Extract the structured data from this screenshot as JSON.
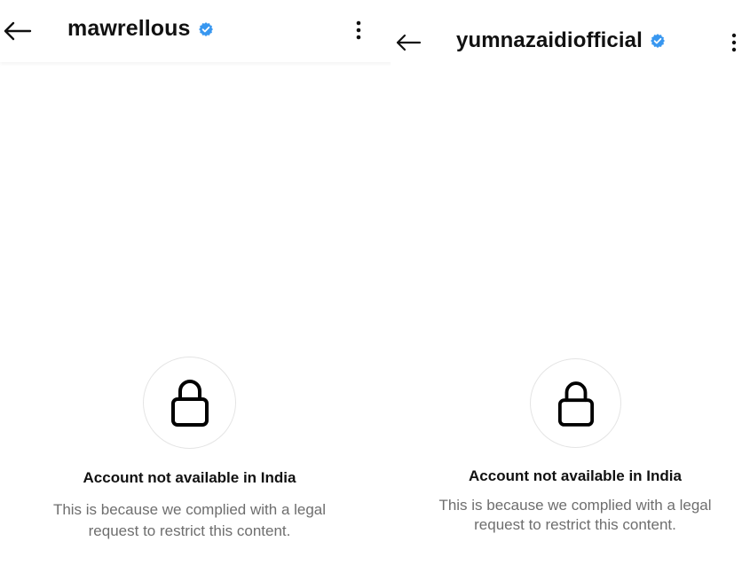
{
  "screens": [
    {
      "username": "mawrellous",
      "verified": true,
      "icons": {
        "back": "back-arrow-icon",
        "verified": "verified-badge-icon",
        "more": "more-options-icon",
        "lock": "lock-icon"
      },
      "message": {
        "heading": "Account not available in India",
        "line1": "This is because we complied with a legal",
        "line2": "request to restrict this content."
      }
    },
    {
      "username": "yumnazaidiofficial",
      "verified": true,
      "icons": {
        "back": "back-arrow-icon",
        "verified": "verified-badge-icon",
        "more": "more-options-icon",
        "lock": "lock-icon"
      },
      "message": {
        "heading": "Account not available in India",
        "line1": "This is because we complied with a legal",
        "line2": "request to restrict this content."
      }
    }
  ],
  "colors": {
    "verified_badge": "#3897f0",
    "heading_text": "#111111",
    "secondary_text": "#6e6e6e",
    "circle_border": "#e4e4e4",
    "background": "#ffffff"
  }
}
